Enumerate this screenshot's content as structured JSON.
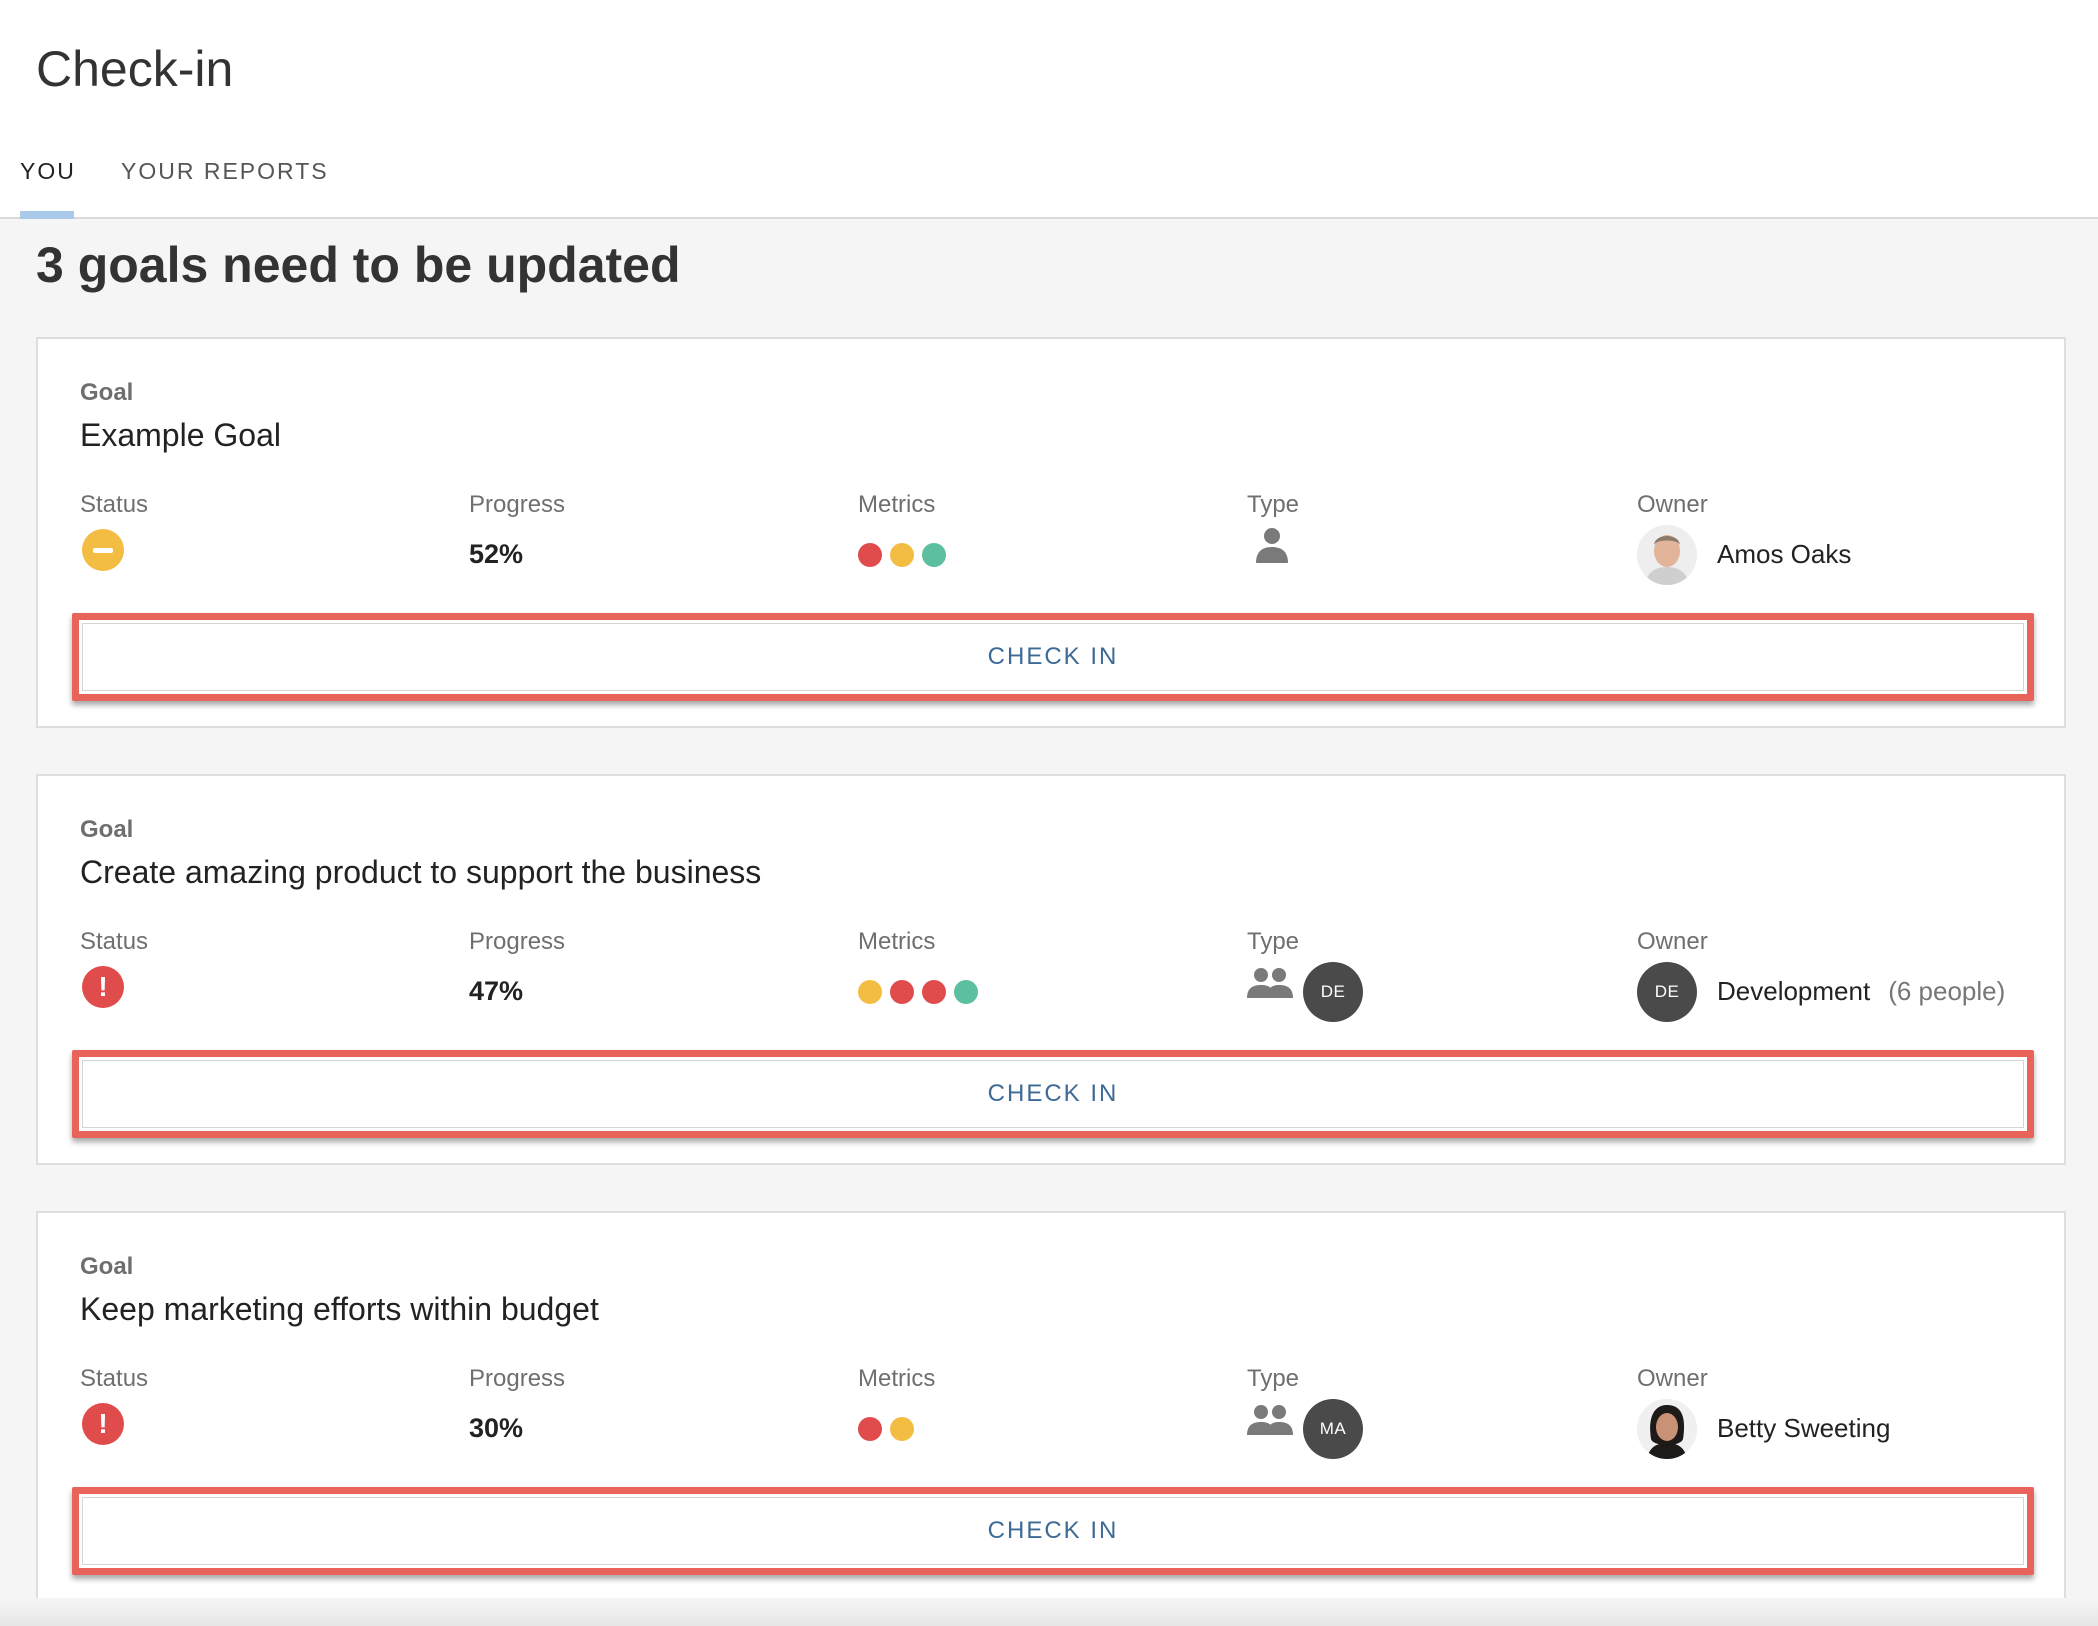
{
  "page": {
    "title": "Check-in",
    "tabs": [
      {
        "label": "YOU",
        "active": true
      },
      {
        "label": "YOUR REPORTS",
        "active": false
      }
    ],
    "headline": "3 goals need to be updated"
  },
  "column_labels": {
    "status": "Status",
    "progress": "Progress",
    "metrics": "Metrics",
    "type": "Type",
    "owner": "Owner"
  },
  "colors": {
    "red": "#e04b4b",
    "yellow": "#f2bd42",
    "green": "#5cbf9f",
    "highlight": "#e8645a",
    "link": "#3d6b96"
  },
  "goals": [
    {
      "kicker": "Goal",
      "title": "Example Goal",
      "status": "warning",
      "status_icon": "minus-circle-icon",
      "progress": "52%",
      "metrics": [
        "red",
        "yellow",
        "green"
      ],
      "type": "individual",
      "type_icon": "person-icon",
      "type_badge": "",
      "owner_avatar": "photo",
      "owner_name": "Amos Oaks",
      "owner_extra": "",
      "button": "CHECK IN"
    },
    {
      "kicker": "Goal",
      "title": "Create amazing product to support the business",
      "status": "danger",
      "status_icon": "exclamation-circle-icon",
      "progress": "47%",
      "metrics": [
        "yellow",
        "red",
        "red",
        "green"
      ],
      "type": "team",
      "type_icon": "group-icon",
      "type_badge": "DE",
      "owner_avatar": "DE",
      "owner_name": "Development",
      "owner_extra": "(6 people)",
      "button": "CHECK IN"
    },
    {
      "kicker": "Goal",
      "title": "Keep marketing efforts within budget",
      "status": "danger",
      "status_icon": "exclamation-circle-icon",
      "progress": "30%",
      "metrics": [
        "red",
        "yellow"
      ],
      "type": "team",
      "type_icon": "group-icon",
      "type_badge": "MA",
      "owner_avatar": "photo",
      "owner_name": "Betty Sweeting",
      "owner_extra": "",
      "button": "CHECK IN"
    }
  ]
}
